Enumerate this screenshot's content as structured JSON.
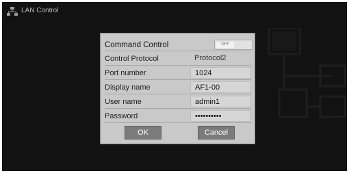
{
  "app": {
    "title": "LAN Control",
    "icon": "network-icon"
  },
  "dialog": {
    "title": "Command Control",
    "toggle_label": "OFF",
    "rows": [
      {
        "label": "Control Protocol",
        "value": "Protocol2"
      },
      {
        "label": "Port number",
        "value": "1024"
      },
      {
        "label": "Display name",
        "value": "AF1-00"
      },
      {
        "label": "User name",
        "value": "admin1"
      },
      {
        "label": "Password",
        "value": "••••••••••"
      }
    ],
    "ok_label": "OK",
    "cancel_label": "Cancel"
  },
  "colors": {
    "screen_bg": "#121212",
    "dialog_bg": "#c9c9c9",
    "button_bg": "#7b7b7b"
  }
}
